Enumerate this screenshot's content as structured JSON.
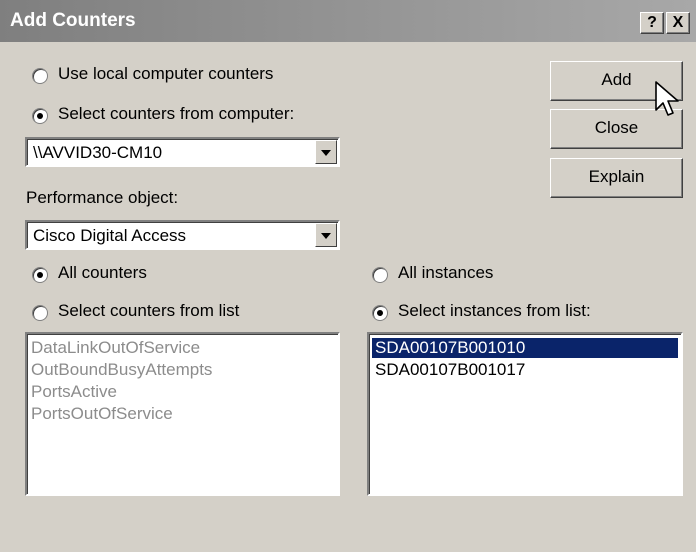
{
  "window": {
    "title": "Add Counters",
    "help_btn": "?",
    "close_btn": "X"
  },
  "computer": {
    "local_label": "Use local computer counters",
    "local_selected": false,
    "select_label": "Select counters from computer:",
    "select_selected": true,
    "value": "\\\\AVVID30-CM10"
  },
  "performance_object": {
    "label": "Performance object:",
    "value": "Cisco Digital Access"
  },
  "counters": {
    "all_label": "All counters",
    "all_selected": true,
    "from_list_label": "Select counters from list",
    "from_list_selected": false,
    "items": [
      "DataLinkOutOfService",
      "OutBoundBusyAttempts",
      "PortsActive",
      "PortsOutOfService"
    ],
    "enabled": false
  },
  "instances": {
    "all_label": "All instances",
    "all_selected": false,
    "from_list_label": "Select instances from list:",
    "from_list_selected": true,
    "items": [
      "SDA00107B001010",
      "SDA00107B001017"
    ],
    "selected_index": 0
  },
  "buttons": {
    "add": "Add",
    "close": "Close",
    "explain": "Explain"
  },
  "colors": {
    "dialog_bg": "#d4d0c8",
    "selection": "#0a246a",
    "disabled_text": "#8c8c8c"
  }
}
